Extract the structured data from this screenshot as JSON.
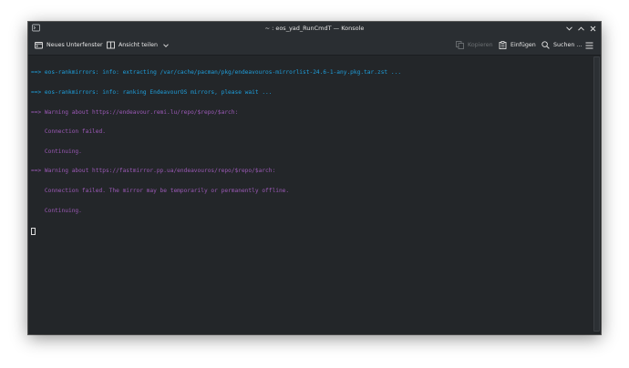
{
  "window": {
    "title": "~ : eos_yad_RunCmdT — Konsole"
  },
  "toolbar": {
    "new_tab_label": "Neues Unterfenster",
    "split_view_label": "Ansicht teilen",
    "copy_label": "Kopieren",
    "paste_label": "Einfügen",
    "search_label": "Suchen …"
  },
  "terminal": {
    "lines": [
      {
        "text": "==> eos-rankmirrors: info: extracting /var/cache/pacman/pkg/endeavouros-mirrorlist-24.6-1-any.pkg.tar.zst ...",
        "color": "#1e9edb"
      },
      {
        "text": "==> eos-rankmirrors: info: ranking EndeavourOS mirrors, please wait ...",
        "color": "#1e9edb"
      },
      {
        "text": "==> Warning about https://endeavour.remi.lu/repo/$repo/$arch:",
        "color": "#9b59b6"
      },
      {
        "text": "    Connection failed.",
        "color": "#9b59b6"
      },
      {
        "text": "    Continuing.",
        "color": "#9b59b6"
      },
      {
        "text": "==> Warning about https://fastmirror.pp.ua/endeavouros/repo/$repo/$arch:",
        "color": "#9b59b6"
      },
      {
        "text": "    Connection failed. The mirror may be temporarily or permanently offline.",
        "color": "#9b59b6"
      },
      {
        "text": "    Continuing.",
        "color": "#9b59b6"
      }
    ]
  },
  "icons": {
    "app": "konsole-icon",
    "minimize": "chevron-down-icon",
    "maximize": "chevron-up-icon",
    "close": "close-icon",
    "new_tab": "new-tab-icon",
    "split_view": "split-view-icon",
    "copy": "copy-icon",
    "paste": "paste-icon",
    "search": "search-icon",
    "menu": "hamburger-menu-icon"
  },
  "colors": {
    "terminal_bg": "#232629",
    "info_text": "#1e9edb",
    "warning_text": "#9b59b6"
  }
}
